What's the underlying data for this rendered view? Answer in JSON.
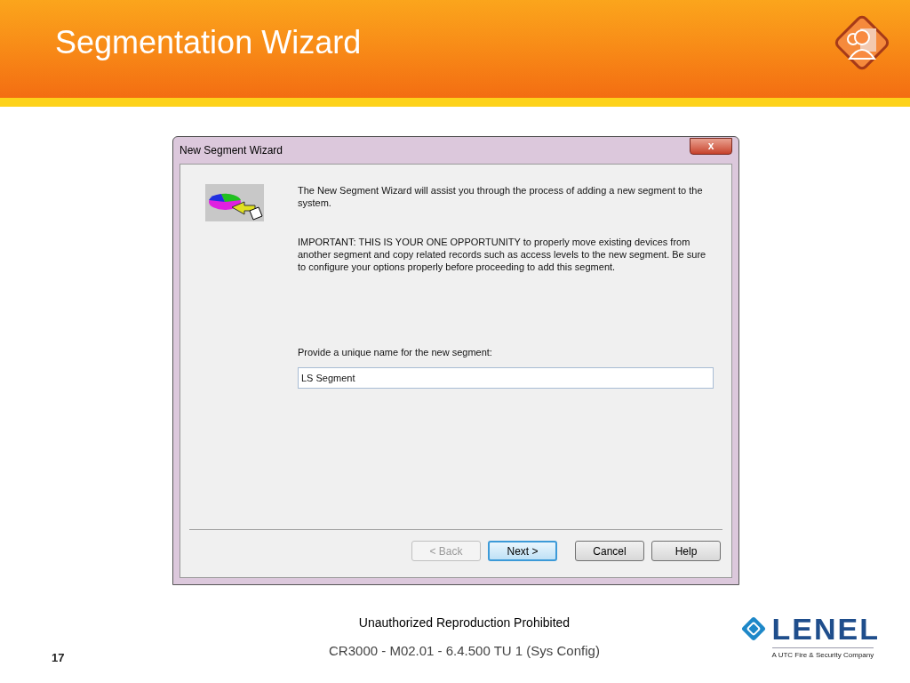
{
  "slide": {
    "title": "Segmentation Wizard",
    "footer_notice": "Unauthorized Reproduction Prohibited",
    "page_number": "17",
    "course": "CR3000 - M02.01 - 6.4.500 TU 1 (Sys Config)",
    "logo": {
      "wordmark": "LENEL",
      "tagline": "A UTC Fire & Security Company"
    }
  },
  "dialog": {
    "title": "New Segment Wizard",
    "close": "x",
    "intro": "The New Segment Wizard will assist you through the process of adding a new segment to the system.",
    "important": "IMPORTANT: THIS IS YOUR ONE OPPORTUNITY to properly move existing devices from another segment and copy related records such as access levels to the new segment. Be sure to configure your options properly before proceeding to add this segment.",
    "name_label": "Provide a unique name for the new segment:",
    "name_value": "LS Segment",
    "buttons": [
      {
        "label": "< Back",
        "disabled": true,
        "default": false
      },
      {
        "label": "Next >",
        "disabled": false,
        "default": true
      },
      {
        "label": "Cancel",
        "disabled": false,
        "default": false
      },
      {
        "label": "Help",
        "disabled": false,
        "default": false
      }
    ]
  }
}
